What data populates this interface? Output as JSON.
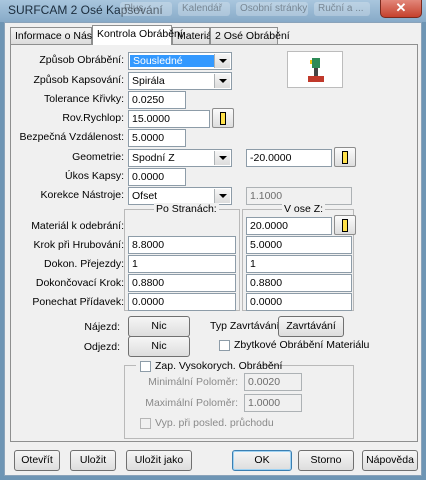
{
  "window": {
    "title": "SURFCAM 2 Osé Kapsování",
    "ghost_tabs": [
      "Plus",
      "Kalendář",
      "Osobní stránky",
      "Ruční a ..."
    ],
    "close_label": "✕"
  },
  "tabs": [
    "Informace o Nástroji",
    "Kontrola Obrábění",
    "Materiál",
    "2 Osé Obrábění"
  ],
  "fields": {
    "zpusob_obrabeni": {
      "label": "Způsob Obrábění:",
      "value": "Sousledné"
    },
    "zpusob_kapsovani": {
      "label": "Způsob Kapsování:",
      "value": "Spirála"
    },
    "tolerance_krivky": {
      "label": "Tolerance Křivky:",
      "value": "0.0250"
    },
    "rov_rychlop": {
      "label": "Rov.Rychlop:",
      "value": "15.0000"
    },
    "bezpecna_vzdalenost": {
      "label": "Bezpečná Vzdálenost:",
      "value": "5.0000"
    },
    "geometrie": {
      "label": "Geometrie:",
      "value": "Spodní Z",
      "z_value": "-20.0000"
    },
    "ukos_kapsy": {
      "label": "Úkos Kapsy:",
      "value": "0.0000"
    },
    "korekce_nastroje": {
      "label": "Korekce Nástroje:",
      "value": "Ofset",
      "extra": "1.1000"
    }
  },
  "table": {
    "col_headers": [
      "Po Stranách:",
      "V ose Z:"
    ],
    "rows": [
      {
        "label": "Materiál k odebrání:",
        "side": "",
        "z": "20.0000"
      },
      {
        "label": "Krok při Hrubování:",
        "side": "8.8000",
        "z": "5.0000"
      },
      {
        "label": "Dokon. Přejezdy:",
        "side": "1",
        "z": "1"
      },
      {
        "label": "Dokončovací Krok:",
        "side": "0.8800",
        "z": "0.8800"
      },
      {
        "label": "Ponechat Přídavek:",
        "side": "0.0000",
        "z": "0.0000"
      }
    ]
  },
  "entry": {
    "najezd_label": "Nájezd:",
    "najezd_btn": "Nic",
    "odjezd_label": "Odjezd:",
    "odjezd_btn": "Nic",
    "typ_zavrt_label": "Typ Zavrtávání:",
    "typ_zavrt_btn": "Zavrtávání",
    "zbytkove_label": "Zbytkové Obrábění Materiálu"
  },
  "hsm": {
    "enable_label": "Zap. Vysokorych. Obrábění",
    "min_label": "Minimální Poloměr:",
    "min_value": "0.0020",
    "max_label": "Maximální Poloměr:",
    "max_value": "1.0000",
    "vyp_label": "Vyp. při posled. průchodu"
  },
  "buttons": {
    "open": "Otevřít",
    "save": "Uložit",
    "save_as": "Uložit jako",
    "ok": "OK",
    "cancel": "Storno",
    "help": "Nápověda"
  },
  "info_button": "i"
}
